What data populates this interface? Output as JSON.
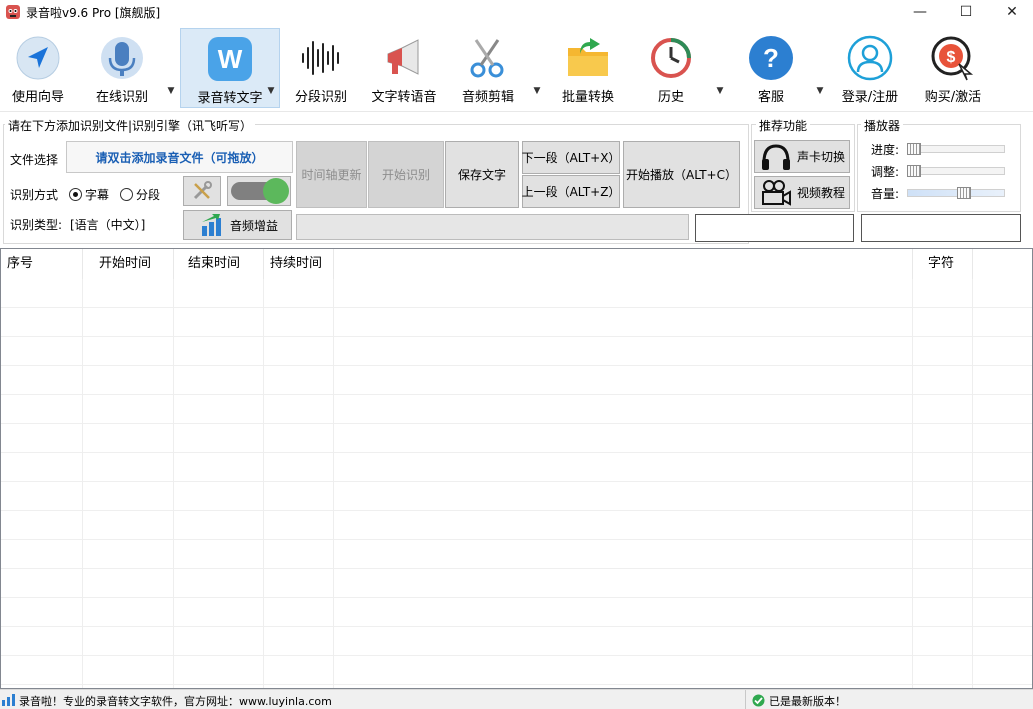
{
  "window": {
    "title": "录音啦v9.6 Pro [旗舰版]",
    "minimize": "—",
    "maximize": "☐",
    "close": "✕"
  },
  "toolbar": {
    "items": [
      {
        "label": "使用向导",
        "icon": "navigation-arrow-icon"
      },
      {
        "label": "在线识别",
        "icon": "microphone-icon"
      },
      {
        "label": "录音转文字",
        "icon": "w-letter-icon"
      },
      {
        "label": "分段识别",
        "icon": "waveform-icon"
      },
      {
        "label": "文字转语音",
        "icon": "megaphone-icon"
      },
      {
        "label": "音频剪辑",
        "icon": "scissors-icon"
      },
      {
        "label": "批量转换",
        "icon": "folder-icon"
      },
      {
        "label": "历史",
        "icon": "clock-history-icon"
      },
      {
        "label": "客服",
        "icon": "help-question-icon"
      },
      {
        "label": "登录/注册",
        "icon": "user-icon"
      },
      {
        "label": "购买/激活",
        "icon": "dollar-coin-icon"
      }
    ],
    "dropdown_arrow": "▼"
  },
  "file_group": {
    "title": "请在下方添加识别文件|识别引擎（讯飞听写）",
    "file_label": "文件选择",
    "file_button": "请双击添加录音文件（可拖放）",
    "mode_label": "识别方式",
    "mode_options": [
      "字幕",
      "分段"
    ],
    "mode_selected": "字幕",
    "type_label": "识别类型:",
    "type_value": "[语言（中文）]",
    "audio_gain_button": "音频增益",
    "timeline_button": "时间轴更新",
    "start_recognition_button": "开始识别",
    "save_text_button": "保存文字",
    "next_button": "下一段（ALT+X）",
    "prev_button": "上一段（ALT+Z）",
    "play_button": "开始播放（ALT+C）"
  },
  "recommend_group": {
    "title": "推荐功能",
    "sound_card_button": "声卡切换",
    "video_tutorial_button": "视频教程"
  },
  "player_group": {
    "title": "播放器",
    "progress_label": "进度:",
    "adjust_label": "调整:",
    "volume_label": "音量:",
    "progress_value": 0,
    "adjust_value": 0,
    "volume_value": 0.6
  },
  "table": {
    "columns": [
      "序号",
      "开始时间",
      "结束时间",
      "持续时间",
      "",
      "字符"
    ],
    "rows": []
  },
  "statusbar": {
    "left_text": "录音啦！专业的录音转文字软件，官方网址：www.luyinla.com",
    "right_text": "已是最新版本！"
  },
  "colors": {
    "accent": "#0078d7",
    "toolbar_active": "#dbeaf7",
    "toggle_green": "#5cb85c"
  }
}
